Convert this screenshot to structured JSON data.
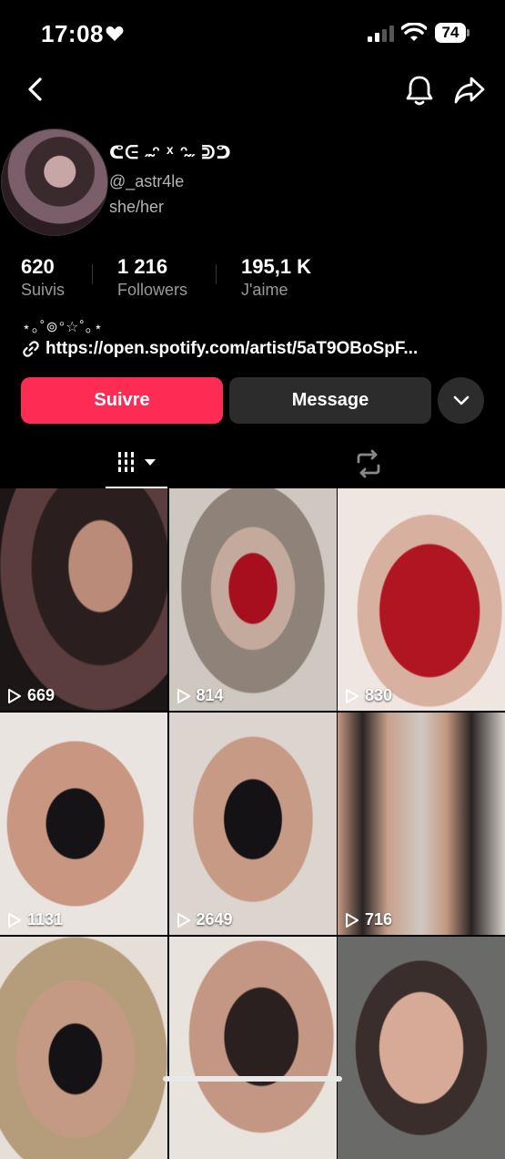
{
  "status_bar": {
    "time": "17:08",
    "battery": "74"
  },
  "profile": {
    "name": "ᕦᕮ ˶̴ᵔ ˣ ᵔ̴˶ ᕲᕤ",
    "handle": "@_astr4le",
    "pronouns": "she/her"
  },
  "stats": [
    {
      "value": "620",
      "label": "Suivis"
    },
    {
      "value": "1 216",
      "label": "Followers"
    },
    {
      "value": "195,1 K",
      "label": "J'aime"
    }
  ],
  "bio": "⋆｡˚⊚°☆˚｡⋆",
  "bio_link": "https://open.spotify.com/artist/5aT9OBoSpF...",
  "buttons": {
    "follow": "Suivre",
    "message": "Message"
  },
  "videos": [
    {
      "plays": "669"
    },
    {
      "plays": "814"
    },
    {
      "plays": "830"
    },
    {
      "plays": "1131"
    },
    {
      "plays": "2649"
    },
    {
      "plays": "716"
    },
    {
      "plays": ""
    },
    {
      "plays": ""
    },
    {
      "plays": ""
    }
  ],
  "colors": {
    "accent": "#fe2c55",
    "background": "#000000",
    "button_dark": "#2c2c2c",
    "muted": "#9a9a9a"
  },
  "icons": [
    "heart-icon",
    "signal-icon",
    "wifi-icon",
    "back-icon",
    "bell-icon",
    "share-icon",
    "link-icon",
    "chevron-down-icon",
    "grid-icon",
    "repost-icon",
    "play-icon"
  ]
}
